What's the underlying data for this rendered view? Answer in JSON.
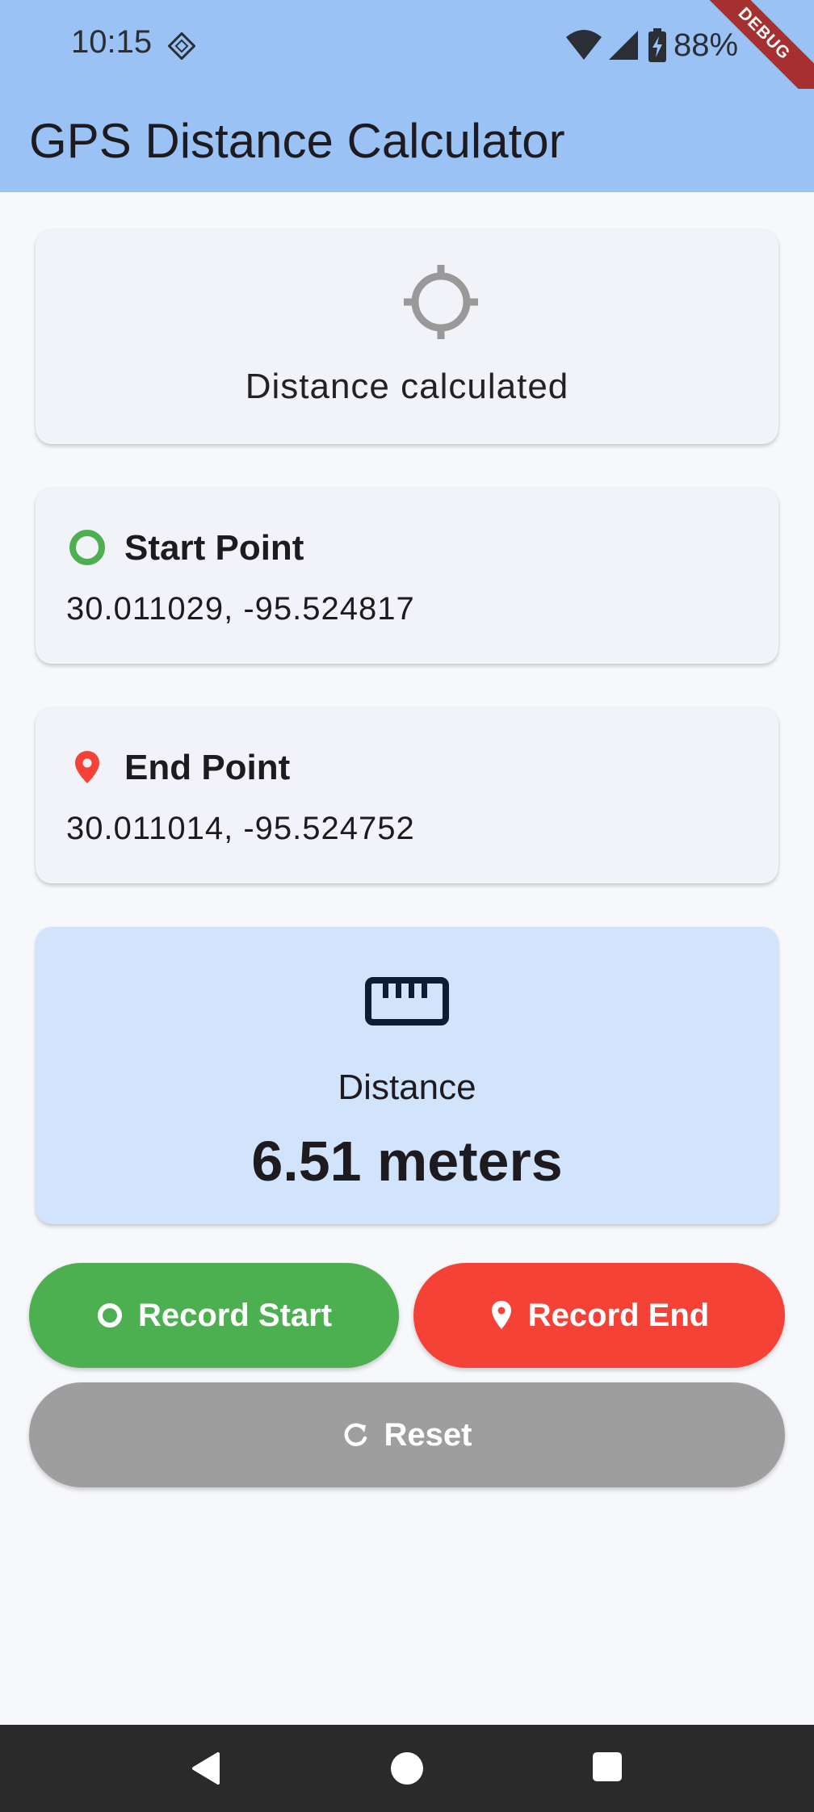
{
  "status_bar": {
    "time": "10:15",
    "battery": "88%",
    "debug_banner": "DEBUG"
  },
  "app_bar": {
    "title": "GPS Distance Calculator"
  },
  "status_card": {
    "icon": "gps-crosshair-icon",
    "message": "Distance calculated"
  },
  "start_point": {
    "icon": "radio-button-circle-icon",
    "label": "Start Point",
    "coordinates": "30.011029, -95.524817"
  },
  "end_point": {
    "icon": "location-pin-icon",
    "label": "End Point",
    "coordinates": "30.011014, -95.524752"
  },
  "distance_card": {
    "icon": "ruler-icon",
    "label": "Distance",
    "value": "6.51 meters"
  },
  "buttons": {
    "record_start": "Record Start",
    "record_end": "Record End",
    "reset": "Reset"
  },
  "colors": {
    "app_bar": "#9BC2F4",
    "start_green": "#4CAF50",
    "end_red": "#F44336",
    "reset_grey": "#9E9E9E",
    "distance_card_bg": "#D2E3FC"
  }
}
